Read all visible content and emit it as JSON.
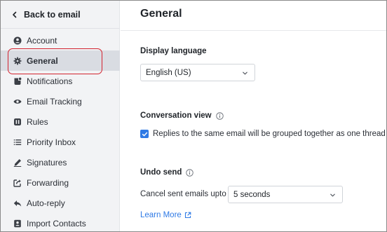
{
  "sidebar": {
    "back_label": "Back to email",
    "items": [
      {
        "label": "Account",
        "icon": "account-icon"
      },
      {
        "label": "General",
        "icon": "gear-icon",
        "active": true
      },
      {
        "label": "Notifications",
        "icon": "notifications-icon"
      },
      {
        "label": "Email Tracking",
        "icon": "eye-icon"
      },
      {
        "label": "Rules",
        "icon": "rules-icon"
      },
      {
        "label": "Priority Inbox",
        "icon": "priority-icon"
      },
      {
        "label": "Signatures",
        "icon": "pen-icon"
      },
      {
        "label": "Forwarding",
        "icon": "forward-icon"
      },
      {
        "label": "Auto-reply",
        "icon": "reply-icon"
      },
      {
        "label": "Import Contacts",
        "icon": "contacts-icon"
      }
    ]
  },
  "main": {
    "title": "General",
    "display_language": {
      "label": "Display language",
      "value": "English (US)"
    },
    "conversation_view": {
      "label": "Conversation view",
      "checkbox_label": "Replies to the same email will be grouped together as one thread",
      "checked": true
    },
    "undo_send": {
      "label": "Undo send",
      "cancel_label": "Cancel sent emails upto",
      "value": "5 seconds",
      "learn_more": "Learn More"
    }
  },
  "colors": {
    "accent": "#2f7ae5",
    "highlight_outline": "#d3232f",
    "sidebar_bg": "#f2f3f5",
    "active_bg": "#d9dce2"
  }
}
